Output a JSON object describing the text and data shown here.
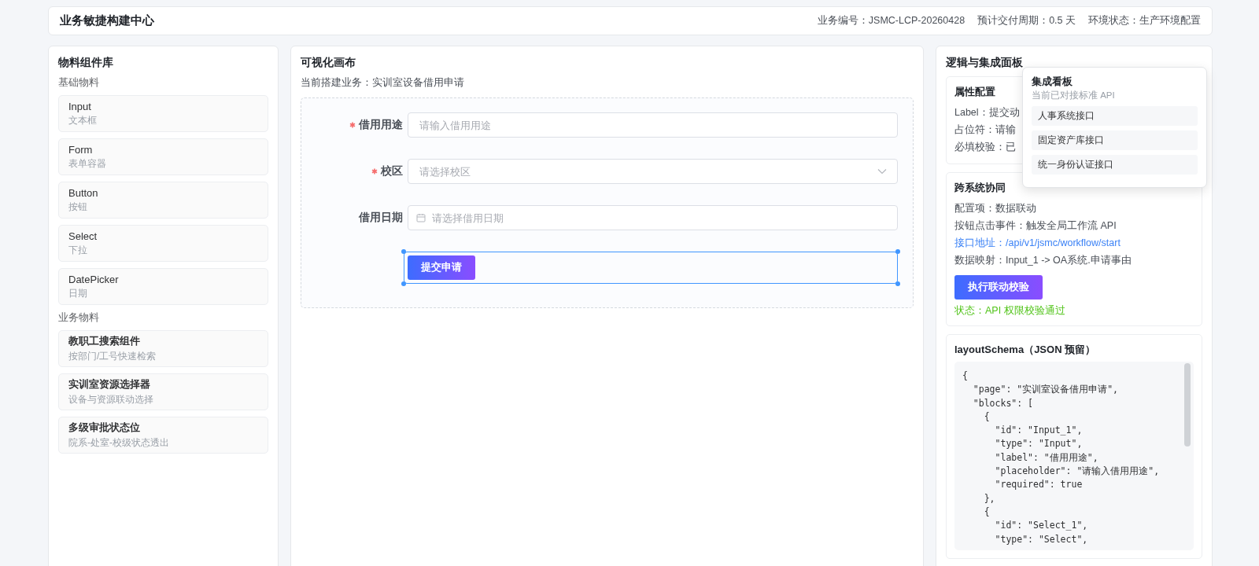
{
  "header": {
    "title": "业务敏捷构建中心",
    "meta": [
      "业务编号：JSMC-LCP-20260428",
      "预计交付周期：0.5 天",
      "环境状态：生产环境配置"
    ]
  },
  "library": {
    "title": "物料组件库",
    "groups": [
      {
        "title": "基础物料",
        "items": [
          {
            "name": "Input",
            "desc": "文本框",
            "kind": "basic"
          },
          {
            "name": "Form",
            "desc": "表单容器",
            "kind": "basic"
          },
          {
            "name": "Button",
            "desc": "按钮",
            "kind": "basic"
          },
          {
            "name": "Select",
            "desc": "下拉",
            "kind": "basic"
          },
          {
            "name": "DatePicker",
            "desc": "日期",
            "kind": "basic"
          }
        ]
      },
      {
        "title": "业务物料",
        "items": [
          {
            "name": "教职工搜索组件",
            "desc": "按部门/工号快速检索",
            "kind": "business"
          },
          {
            "name": "实训室资源选择器",
            "desc": "设备与资源联动选择",
            "kind": "business"
          },
          {
            "name": "多级审批状态位",
            "desc": "院系-处室-校级状态透出",
            "kind": "business"
          }
        ]
      }
    ]
  },
  "canvas": {
    "title": "可视化画布",
    "subtitle": "当前搭建业务：实训室设备借用申请",
    "fields": [
      {
        "kind": "input",
        "label": "借用用途",
        "required": true,
        "placeholder": "请输入借用用途"
      },
      {
        "kind": "select",
        "label": "校区",
        "required": true,
        "placeholder": "请选择校区"
      },
      {
        "kind": "date",
        "label": "借用日期",
        "required": false,
        "placeholder": "请选择借用日期"
      }
    ],
    "submit": {
      "label": "提交申请",
      "selected": true
    }
  },
  "panel": {
    "title": "逻辑与集成面板",
    "properties": {
      "title": "属性配置",
      "lines": [
        "Label：提交动",
        "占位符：请输",
        "必填校验：已"
      ]
    },
    "popover": {
      "title": "集成看板",
      "subtitle": "当前已对接标准 API",
      "items": [
        "人事系统接口",
        "固定资产库接口",
        "统一身份认证接口"
      ]
    },
    "collab": {
      "title": "跨系统协同",
      "lines": [
        {
          "kind": "text",
          "text": "配置项：数据联动"
        },
        {
          "kind": "text",
          "text": "按钮点击事件：触发全局工作流 API"
        },
        {
          "kind": "link",
          "text": "接口地址：/api/v1/jsmc/workflow/start"
        },
        {
          "kind": "text",
          "text": "数据映射：Input_1 -> OA系统.申请事由"
        }
      ],
      "button": "执行联动校验",
      "status": "状态：API 权限校验通过"
    },
    "schema": {
      "title": "layoutSchema（JSON 预留）",
      "code": [
        "{",
        "  \"page\": \"实训室设备借用申请\",",
        "  \"blocks\": [",
        "    {",
        "      \"id\": \"Input_1\",",
        "      \"type\": \"Input\",",
        "      \"label\": \"借用用途\",",
        "      \"placeholder\": \"请输入借用用途\",",
        "      \"required\": true",
        "    },",
        "    {",
        "      \"id\": \"Select_1\",",
        "      \"type\": \"Select\","
      ]
    }
  }
}
